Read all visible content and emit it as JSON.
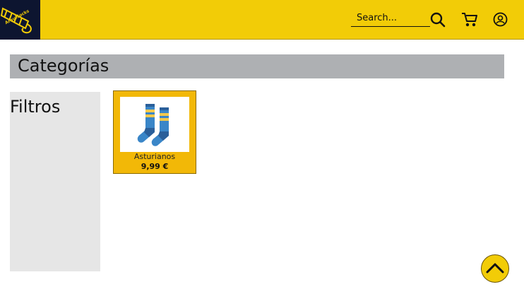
{
  "header": {
    "logo_text": "ArquiSocks",
    "search_placeholder": "Search...",
    "search_value": "",
    "icons": [
      "search-icon",
      "cart-icon",
      "user-icon"
    ]
  },
  "page": {
    "title": "Categorías",
    "filters_title": "Filtros"
  },
  "products": [
    {
      "name": "Asturianos",
      "price": "9,99 €",
      "image_icon": "socks-icon"
    }
  ],
  "colors": {
    "header_bg": "#f2cc07",
    "logo_bg": "#0d1530",
    "title_bar_bg": "#aeb0b3",
    "filters_bg": "#e6e6e6",
    "card_bg": "#f2b807",
    "sock_blue": "#3a86c8",
    "sock_stripe": "#f2c94c"
  },
  "scroll_top_icon": "chevron-up-icon"
}
